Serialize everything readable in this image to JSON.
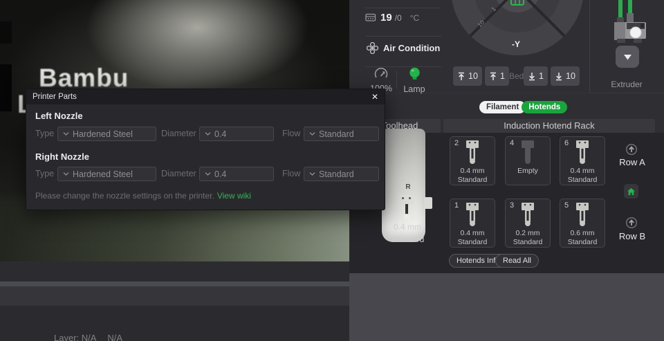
{
  "camera": {
    "brand": "Bambu",
    "brand_second_line": "L",
    "layer_label": "Layer: N/A",
    "layer_value": "N/A"
  },
  "dialog": {
    "title": "Printer Parts",
    "close_glyph": "✕",
    "left_nozzle": {
      "heading": "Left Nozzle",
      "type_label": "Type",
      "type_value": "Hardened Steel",
      "diameter_label": "Diameter",
      "diameter_value": "0.4",
      "flow_label": "Flow",
      "flow_value": "Standard"
    },
    "right_nozzle": {
      "heading": "Right Nozzle",
      "type_label": "Type",
      "type_value": "Hardened Steel",
      "diameter_label": "Diameter",
      "diameter_value": "0.4",
      "flow_label": "Flow",
      "flow_value": "Standard"
    },
    "note": "Please change the nozzle settings on the printer.",
    "wiki_link": "View wiki"
  },
  "controls": {
    "bed_temp": {
      "current": "19",
      "target": "/0",
      "unit": "°C"
    },
    "air_condition_label": "Air Condition",
    "speed_value": "100%",
    "lamp_label": "Lamp",
    "jog": {
      "axis": "-Y",
      "step_inner": "1",
      "step_outer": "10"
    },
    "bed": {
      "up_10": "10",
      "up_1": "1",
      "label": "Bed",
      "down_1": "1",
      "down_10": "10"
    },
    "extruder_label": "Extruder"
  },
  "tabs": {
    "filament": "Filament",
    "hotends": "Hotends"
  },
  "sections": {
    "toolhead": "Toolhead",
    "rack": "Induction Hotend Rack"
  },
  "toolhead": {
    "marker": "R",
    "nozzle_size": "0.4 mm",
    "nozzle_flow": "Standard"
  },
  "rack": {
    "row_a": {
      "label": "Row A",
      "slots": [
        {
          "num": "2",
          "line1": "0.4 mm",
          "line2": "Standard"
        },
        {
          "num": "4",
          "line1": "Empty",
          "line2": ""
        },
        {
          "num": "6",
          "line1": "0.4 mm",
          "line2": "Standard"
        }
      ]
    },
    "row_b": {
      "label": "Row B",
      "slots": [
        {
          "num": "1",
          "line1": "0.4 mm",
          "line2": "Standard"
        },
        {
          "num": "3",
          "line1": "0.2 mm",
          "line2": "Standard"
        },
        {
          "num": "5",
          "line1": "0.6 mm",
          "line2": "Standard"
        }
      ]
    },
    "hotends_info_button": "Hotends Info",
    "read_all_button": "Read All"
  },
  "colors": {
    "accent_green": "#25b14b",
    "toggle_green": "#1ba33e",
    "link_green": "#37b157"
  }
}
